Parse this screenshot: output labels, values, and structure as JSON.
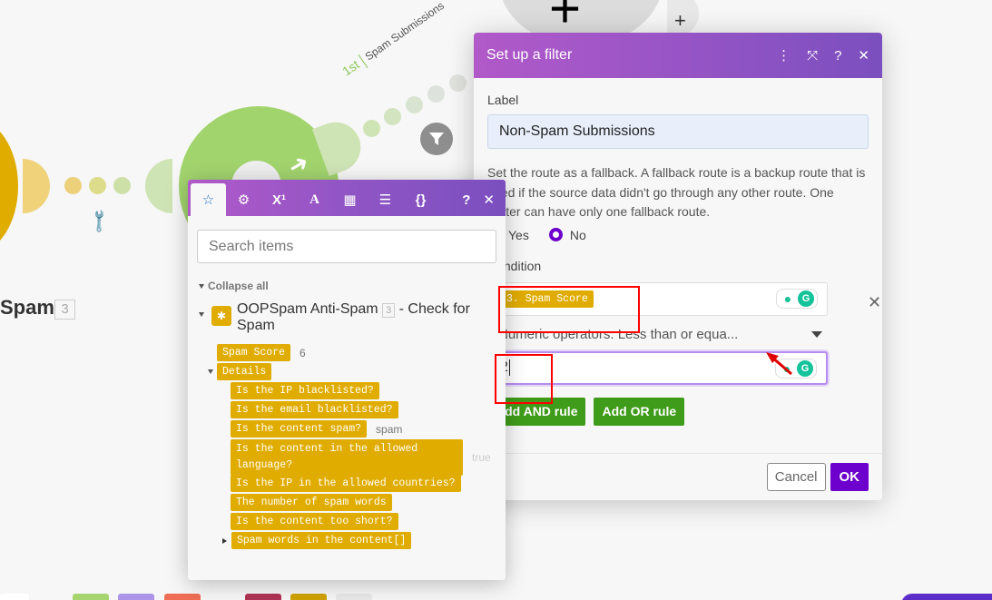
{
  "canvas": {
    "node_label": "Spam",
    "node_badge": "3",
    "route": {
      "order": "1st",
      "name": "Spam Submissions"
    },
    "icons": [
      "wrench-icon",
      "filter-icon",
      "plus-icon",
      "arrow-icon"
    ],
    "colors": {
      "yellow": "#e0ac00",
      "green": "#a2d46e",
      "purple": "#6d00cc"
    }
  },
  "dialog": {
    "title": "Set up a filter",
    "header_icons": [
      "more-vertical-icon",
      "expand-icon",
      "help-icon",
      "close-icon"
    ],
    "label_caption": "Label",
    "label_value": "Non-Spam Submissions",
    "fallback_help": "Set the route as a fallback. A fallback route is a backup route that is used if the source data didn't go through any other route. One router can have only one fallback route.",
    "fallback_options": [
      "Yes",
      "No"
    ],
    "fallback_selected": "No",
    "condition_caption": "Condition",
    "condition": {
      "field_pill": "3. Spam Score",
      "operator": "Numeric operators: Less than or equa...",
      "value": "2"
    },
    "buttons": {
      "add_and": "Add AND rule",
      "add_or": "Add OR rule",
      "cancel": "Cancel",
      "ok": "OK"
    }
  },
  "mapping_panel": {
    "tabs": [
      "favorites",
      "general-functions",
      "math-functions",
      "text-functions",
      "date-functions",
      "array-functions",
      "json-functions"
    ],
    "active_tab": "favorites",
    "search_placeholder": "Search items",
    "collapse_all": "Collapse all",
    "module": {
      "name": "OOPSpam Anti-Spam",
      "badge": "3",
      "suffix": "- Check for Spam"
    },
    "items": [
      {
        "label": "Spam Score",
        "value": "6",
        "level": 0
      },
      {
        "label": "Details",
        "value": "",
        "level": 0,
        "expanded": true
      },
      {
        "label": "Is the IP blacklisted?",
        "value": "",
        "level": 1
      },
      {
        "label": "Is the email blacklisted?",
        "value": "",
        "level": 1
      },
      {
        "label": "Is the content spam?",
        "value": "spam",
        "level": 1
      },
      {
        "label": "Is the content in the allowed language?",
        "value": "true",
        "level": 1
      },
      {
        "label": "Is the IP in the allowed countries?",
        "value": "",
        "level": 1
      },
      {
        "label": "The number of spam words",
        "value": "",
        "level": 1
      },
      {
        "label": "Is the content too short?",
        "value": "",
        "level": 1
      },
      {
        "label": "Spam words in the content[]",
        "value": "",
        "level": 1,
        "collapsed": true
      }
    ]
  }
}
